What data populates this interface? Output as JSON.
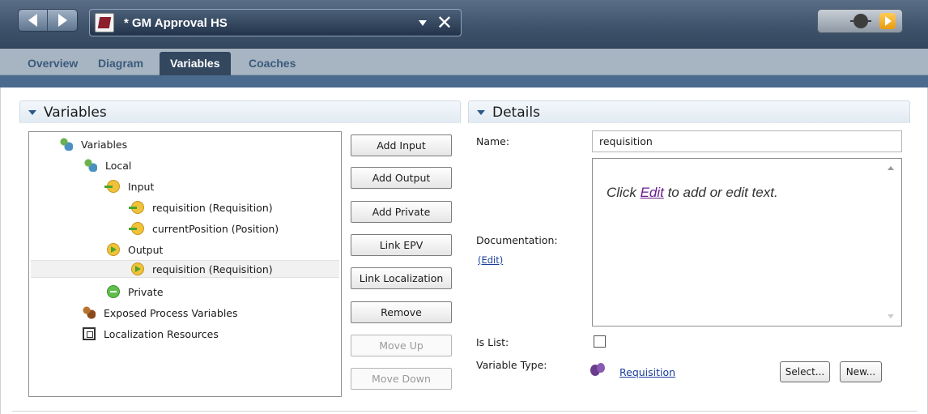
{
  "window": {
    "title": "* GM Approval HS",
    "close_symbol": "✕"
  },
  "tabs": [
    {
      "label": "Overview"
    },
    {
      "label": "Diagram"
    },
    {
      "label": "Variables"
    },
    {
      "label": "Coaches"
    }
  ],
  "variables_panel": {
    "title": "Variables",
    "tree": [
      {
        "label": "Variables",
        "icon": "variables-icon"
      },
      {
        "label": "Local",
        "icon": "variables-icon"
      },
      {
        "label": "Input",
        "icon": "input-arrow-icon"
      },
      {
        "label": "requisition (Requisition)",
        "icon": "input-arrow-icon"
      },
      {
        "label": "currentPosition (Position)",
        "icon": "input-arrow-icon"
      },
      {
        "label": "Output",
        "icon": "output-arrow-icon"
      },
      {
        "label": "requisition (Requisition)",
        "icon": "output-arrow-icon",
        "selected": true
      },
      {
        "label": "Private",
        "icon": "private-icon"
      },
      {
        "label": "Exposed Process Variables",
        "icon": "exposed-process-variables-icon"
      },
      {
        "label": "Localization Resources",
        "icon": "localization-resources-icon"
      }
    ],
    "buttons": [
      {
        "label": "Add Input",
        "enabled": true
      },
      {
        "label": "Add Output",
        "enabled": true
      },
      {
        "label": "Add Private",
        "enabled": true
      },
      {
        "label": "Link EPV",
        "enabled": true
      },
      {
        "label": "Link Localization",
        "enabled": true
      },
      {
        "label": "Remove",
        "enabled": true
      },
      {
        "label": "Move Up",
        "enabled": false
      },
      {
        "label": "Move Down",
        "enabled": false
      }
    ]
  },
  "details_panel": {
    "title": "Details",
    "name_label": "Name:",
    "name_value": "requisition",
    "documentation_label": "Documentation:",
    "documentation_edit_link": "(Edit)",
    "documentation_placeholder_prefix": "Click ",
    "documentation_placeholder_link": "Edit",
    "documentation_placeholder_suffix": " to add or edit text.",
    "is_list_label": "Is List:",
    "is_list_checked": false,
    "variable_type_label": "Variable Type:",
    "variable_type_value": "Requisition",
    "select_button": "Select...",
    "new_button": "New..."
  },
  "colors": {
    "title_bar": "#3d526a",
    "tabs_bar": "#a7b5c3",
    "active_tab": "#33475e",
    "link": "#1a3d9e"
  }
}
